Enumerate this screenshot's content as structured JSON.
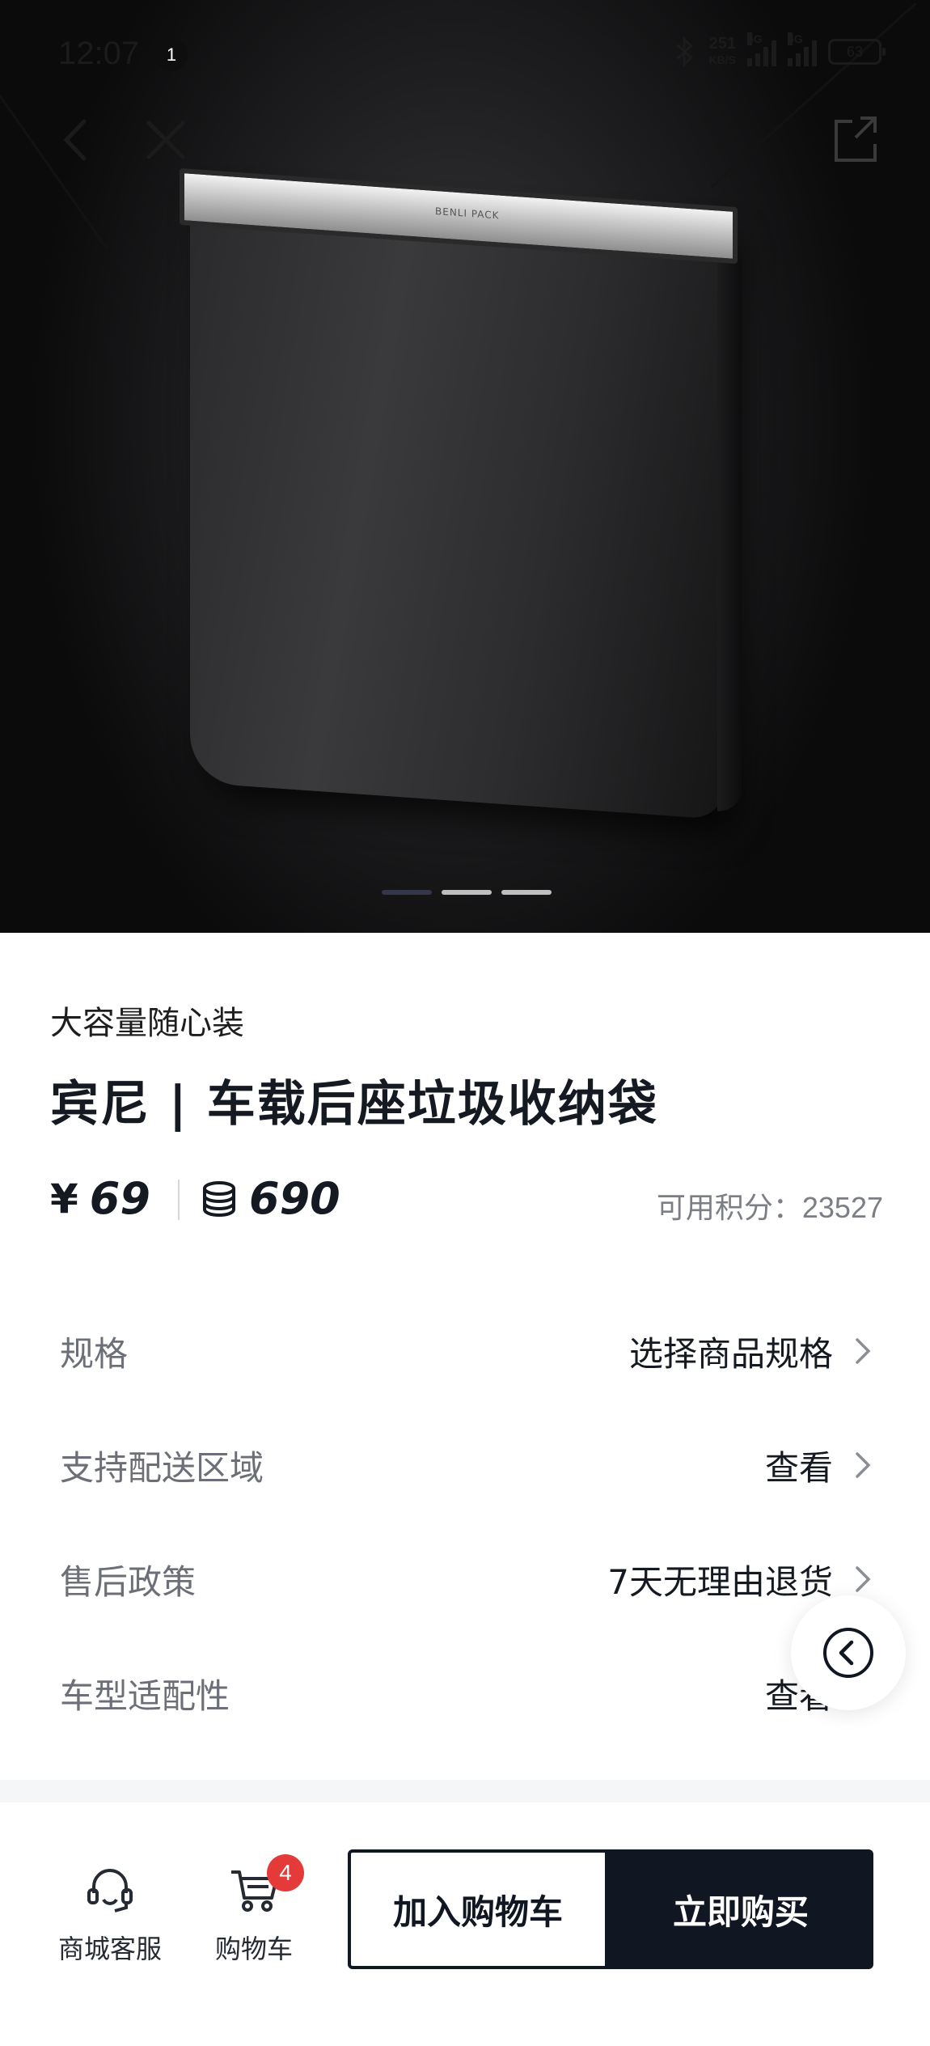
{
  "status_bar": {
    "time": "12:07",
    "notification_count": "1",
    "net_speed": "251",
    "net_speed_unit": "KB/S",
    "signal_1_tag": "5G",
    "signal_2_tag": "5G",
    "battery": "63"
  },
  "hero": {
    "brand_text": "BENLI PACK",
    "carousel_count": 3,
    "carousel_active": 0
  },
  "product": {
    "subtitle": "大容量随心装",
    "title": "宾尼 | 车载后座垃圾收纳袋",
    "price_symbol": "¥",
    "price": "69",
    "coin_price": "690",
    "points_label": "可用积分：",
    "points_value": "23527"
  },
  "info_rows": [
    {
      "label": "规格",
      "value": "选择商品规格"
    },
    {
      "label": "支持配送区域",
      "value": "查看"
    },
    {
      "label": "售后政策",
      "value": "7天无理由退货"
    },
    {
      "label": "车型适配性",
      "value": "查看"
    }
  ],
  "bottom_bar": {
    "service_label": "商城客服",
    "cart_label": "购物车",
    "cart_count": "4",
    "add_to_cart": "加入购物车",
    "buy_now": "立即购买"
  },
  "colors": {
    "primary": "#111722",
    "badge": "#e53a3a",
    "muted_text": "#6c6f78"
  }
}
